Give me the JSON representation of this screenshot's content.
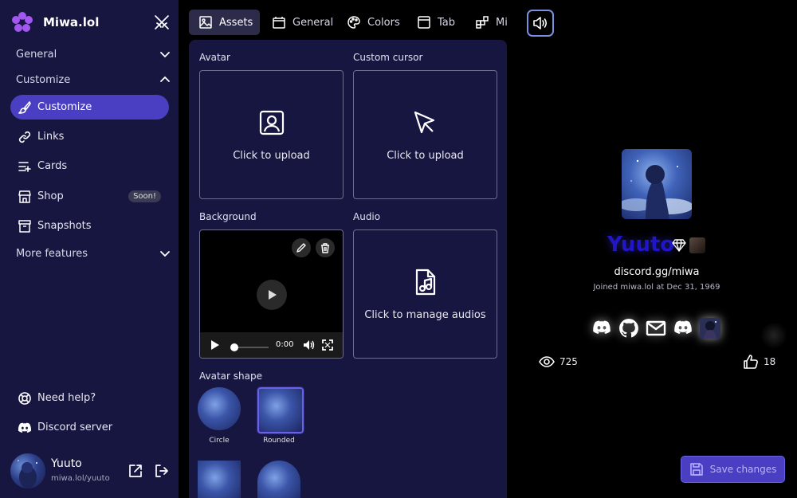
{
  "brand": {
    "name": "Miwa.lol"
  },
  "sidebar": {
    "sections": [
      {
        "label": "General",
        "chevron": "chevron-down-icon"
      },
      {
        "label": "Customize",
        "chevron": "chevron-up-icon"
      }
    ],
    "items": [
      {
        "label": "Customize",
        "icon": "brush-icon",
        "active": true
      },
      {
        "label": "Links",
        "icon": "link-icon"
      },
      {
        "label": "Cards",
        "icon": "cards-icon"
      },
      {
        "label": "Shop",
        "icon": "shop-icon",
        "badge": "Soon!"
      },
      {
        "label": "Snapshots",
        "icon": "archive-icon"
      }
    ],
    "more_features": "More features",
    "help": "Need help?",
    "discord_server": "Discord server"
  },
  "user": {
    "name": "Yuuto",
    "handle": "miwa.lol/yuuto"
  },
  "tabs": [
    {
      "label": "Assets",
      "icon": "image-icon",
      "active": true
    },
    {
      "label": "General",
      "icon": "window-icon"
    },
    {
      "label": "Colors",
      "icon": "palette-icon"
    },
    {
      "label": "Tab",
      "icon": "tab-icon"
    },
    {
      "label": "Misc",
      "icon": "blocks-icon"
    }
  ],
  "assets": {
    "avatar_label": "Avatar",
    "cursor_label": "Custom cursor",
    "background_label": "Background",
    "audio_label": "Audio",
    "upload_text": "Click to upload",
    "manage_audio_text": "Click to manage audios",
    "video_time": "0:00",
    "avatar_shape_label": "Avatar shape",
    "shapes": [
      {
        "label": "Circle"
      },
      {
        "label": "Rounded",
        "selected": true
      }
    ]
  },
  "preview": {
    "name": "Yuuto",
    "description": "discord.gg/miwa",
    "joined": "Joined miwa.lol at Dec 31, 1969",
    "views": "725",
    "likes": "18",
    "accent": "#2016c8"
  },
  "save_button": "Save changes",
  "colors": {
    "sidebar_bg": "#171641",
    "accent": "#4a3fc2"
  }
}
